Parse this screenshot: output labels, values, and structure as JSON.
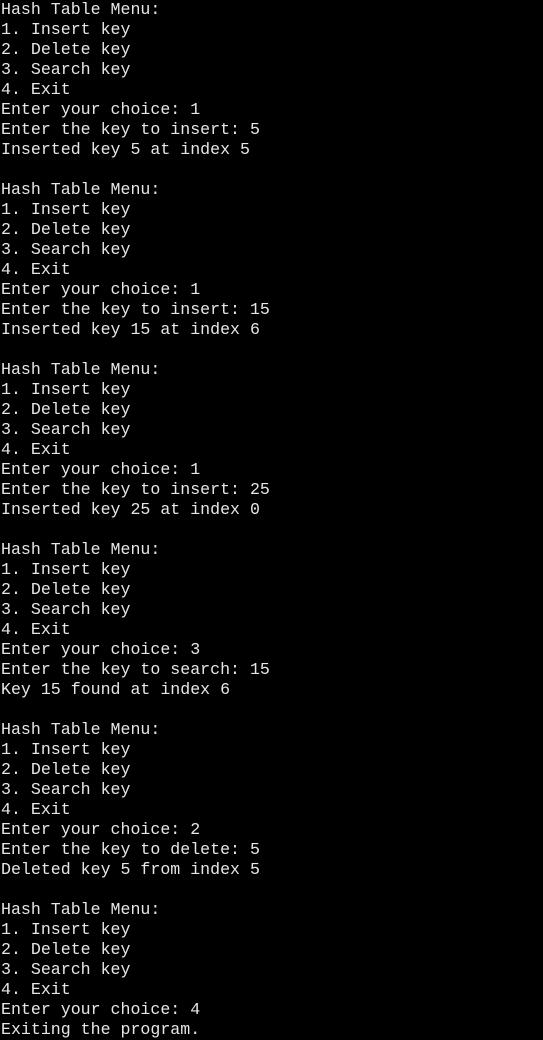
{
  "terminal": {
    "background": "#000000",
    "foreground": "#e6e6e6",
    "lines": [
      "Hash Table Menu:",
      "1. Insert key",
      "2. Delete key",
      "3. Search key",
      "4. Exit",
      "Enter your choice: 1",
      "Enter the key to insert: 5",
      "Inserted key 5 at index 5",
      "",
      "Hash Table Menu:",
      "1. Insert key",
      "2. Delete key",
      "3. Search key",
      "4. Exit",
      "Enter your choice: 1",
      "Enter the key to insert: 15",
      "Inserted key 15 at index 6",
      "",
      "Hash Table Menu:",
      "1. Insert key",
      "2. Delete key",
      "3. Search key",
      "4. Exit",
      "Enter your choice: 1",
      "Enter the key to insert: 25",
      "Inserted key 25 at index 0",
      "",
      "Hash Table Menu:",
      "1. Insert key",
      "2. Delete key",
      "3. Search key",
      "4. Exit",
      "Enter your choice: 3",
      "Enter the key to search: 15",
      "Key 15 found at index 6",
      "",
      "Hash Table Menu:",
      "1. Insert key",
      "2. Delete key",
      "3. Search key",
      "4. Exit",
      "Enter your choice: 2",
      "Enter the key to delete: 5",
      "Deleted key 5 from index 5",
      "",
      "Hash Table Menu:",
      "1. Insert key",
      "2. Delete key",
      "3. Search key",
      "4. Exit",
      "Enter your choice: 4",
      "Exiting the program."
    ]
  }
}
